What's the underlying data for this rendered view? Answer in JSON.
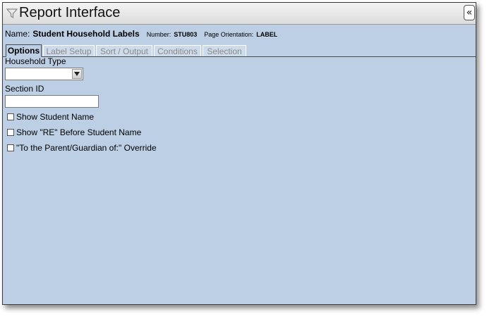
{
  "window": {
    "title": "Report Interface",
    "collapse_icon": "«"
  },
  "info": {
    "name_label": "Name:",
    "name_value": "Student Household Labels",
    "number_label": "Number:",
    "number_value": "STU803",
    "orientation_label": "Page Orientation:",
    "orientation_value": "LABEL"
  },
  "tabs": [
    {
      "label": "Options",
      "active": true
    },
    {
      "label": "Label Setup",
      "active": false
    },
    {
      "label": "Sort / Output",
      "active": false
    },
    {
      "label": "Conditions",
      "active": false
    },
    {
      "label": "Selection",
      "active": false
    }
  ],
  "options": {
    "household_type_label": "Household Type",
    "household_type_value": "",
    "section_id_label": "Section ID",
    "section_id_value": "",
    "checkboxes": [
      {
        "label": "Show Student Name",
        "checked": false
      },
      {
        "label": "Show \"RE\" Before Student Name",
        "checked": false
      },
      {
        "label": "\"To the Parent/Guardian of:\" Override",
        "checked": false
      }
    ]
  }
}
